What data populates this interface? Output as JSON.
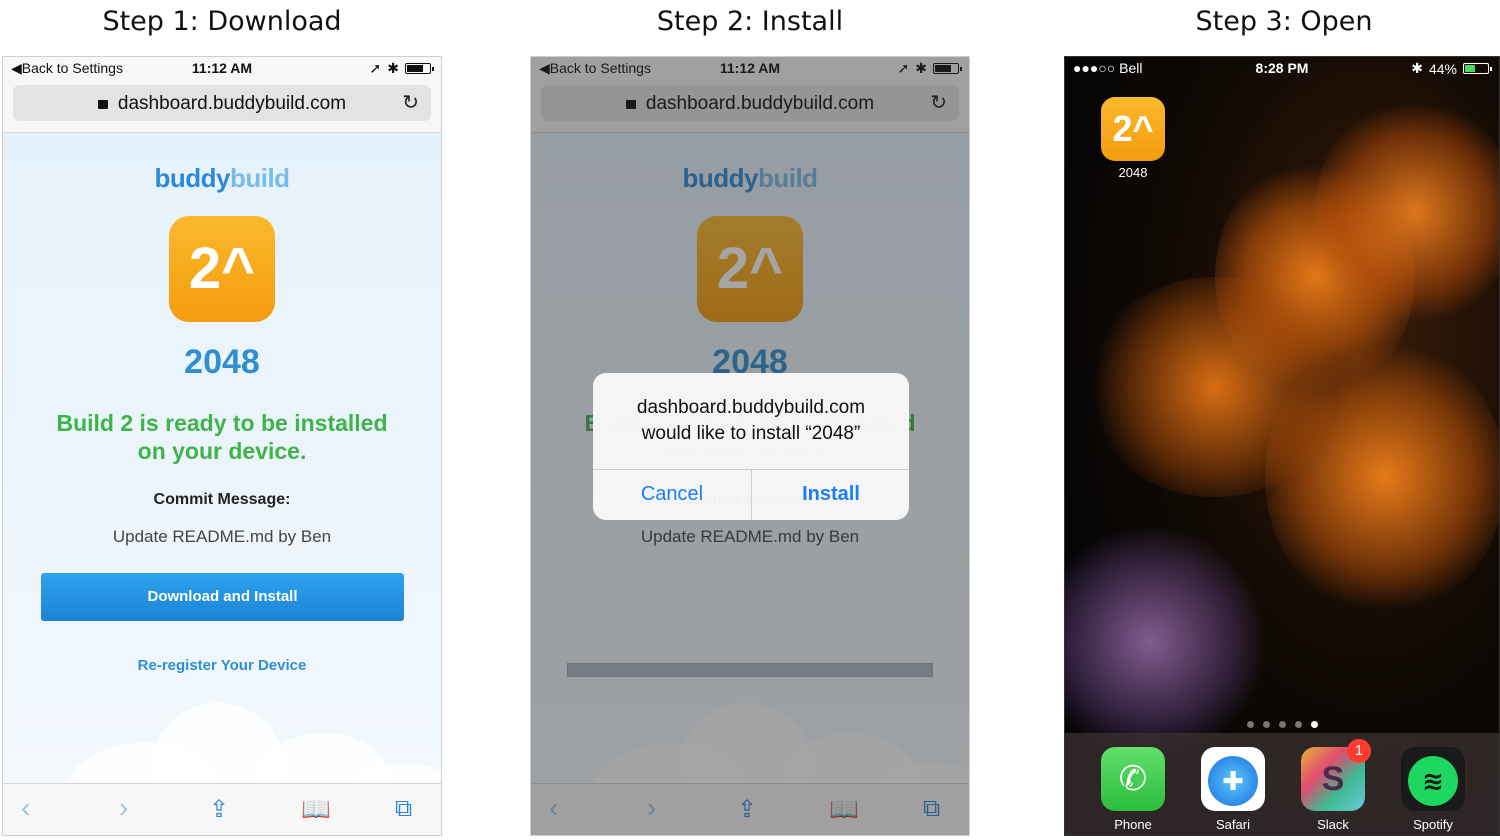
{
  "steps": [
    {
      "title": "Step 1: Download"
    },
    {
      "title": "Step 2: Install"
    },
    {
      "title": "Step 3: Open"
    }
  ],
  "safari": {
    "back_label": "Back to Settings",
    "time": "11:12 AM",
    "url": "dashboard.buddybuild.com"
  },
  "page": {
    "logo_part1": "buddy",
    "logo_part2": "build",
    "app_icon_text": "2^",
    "app_name": "2048",
    "ready_text": "Build 2 is ready to be installed on your device.",
    "commit_label": "Commit Message:",
    "commit_message": "Update README.md by Ben",
    "download_button": "Download and Install",
    "reregister_link": "Re-register Your Device"
  },
  "alert": {
    "line1": "dashboard.buddybuild.com",
    "line2": "would like to install “2048”",
    "cancel": "Cancel",
    "install": "Install"
  },
  "home": {
    "carrier": "●●●○○ Bell",
    "time": "8:28 PM",
    "battery": "44%",
    "app_label": "2048",
    "dock": [
      {
        "label": "Phone"
      },
      {
        "label": "Safari"
      },
      {
        "label": "Slack",
        "badge": "1"
      },
      {
        "label": "Spotify"
      }
    ]
  },
  "colors": {
    "brand_blue": "#2f8fd1",
    "ready_green": "#3eb449",
    "ios_blue": "#1d7df2",
    "app_orange": "#f7a81b"
  }
}
